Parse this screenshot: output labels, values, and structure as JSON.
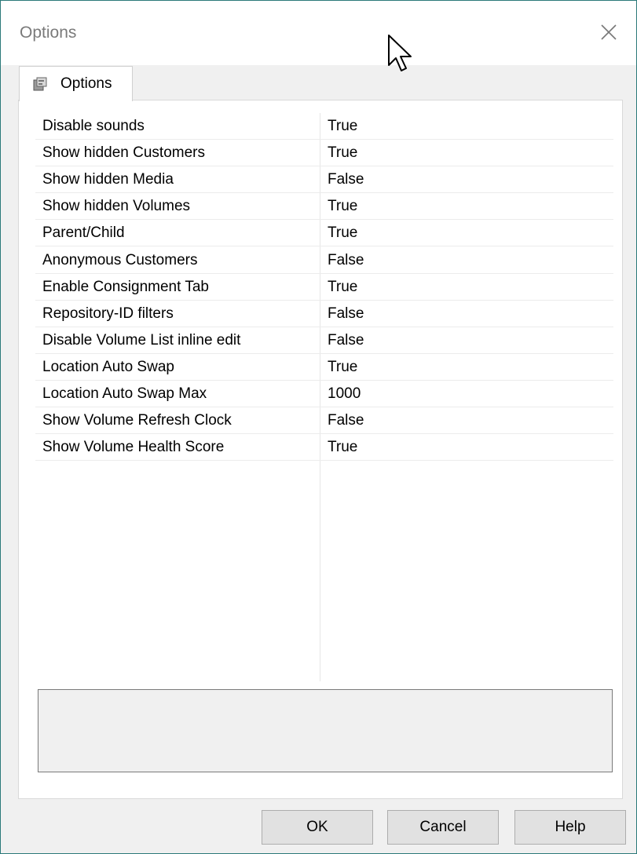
{
  "window": {
    "title": "Options"
  },
  "tab": {
    "label": "Options"
  },
  "options": [
    {
      "name": "Disable sounds",
      "value": "True"
    },
    {
      "name": "Show hidden Customers",
      "value": "True"
    },
    {
      "name": "Show hidden Media",
      "value": "False"
    },
    {
      "name": "Show hidden Volumes",
      "value": "True"
    },
    {
      "name": "Parent/Child",
      "value": "True"
    },
    {
      "name": "Anonymous Customers",
      "value": "False"
    },
    {
      "name": "Enable Consignment Tab",
      "value": "True"
    },
    {
      "name": "Repository-ID filters",
      "value": "False"
    },
    {
      "name": "Disable Volume List inline edit",
      "value": "False"
    },
    {
      "name": "Location Auto Swap",
      "value": "True"
    },
    {
      "name": "Location Auto Swap Max",
      "value": "1000"
    },
    {
      "name": "Show Volume Refresh Clock",
      "value": "False"
    },
    {
      "name": "Show Volume Health Score",
      "value": "True"
    }
  ],
  "buttons": {
    "ok": "OK",
    "cancel": "Cancel",
    "help": "Help"
  },
  "icons": {
    "close": "close-icon",
    "tab": "properties-icon",
    "cursor": "mouse-cursor-icon"
  }
}
